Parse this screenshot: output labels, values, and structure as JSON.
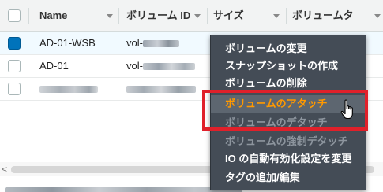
{
  "table": {
    "columns": [
      {
        "label": "Name"
      },
      {
        "label": "ボリューム ID"
      },
      {
        "label": "サイズ"
      },
      {
        "label": "ボリュームタ"
      }
    ],
    "rows": [
      {
        "name": "AD-01-WSB",
        "volume_id_prefix": "vol-",
        "selected": true
      },
      {
        "name": "AD-01",
        "volume_id_prefix": "vol-",
        "selected": false
      },
      {
        "name": "",
        "volume_id_prefix": "",
        "selected": false
      }
    ]
  },
  "scrollbar": {
    "left_arrow": "<"
  },
  "context_menu": {
    "items": [
      {
        "label": "ボリュームの変更",
        "state": "normal"
      },
      {
        "label": "スナップショットの作成",
        "state": "normal"
      },
      {
        "label": "ボリュームの削除",
        "state": "normal"
      },
      {
        "label": "ボリュームのアタッチ",
        "state": "hover"
      },
      {
        "label": "ボリュームのデタッチ",
        "state": "disabled"
      },
      {
        "label": "ボリュームの強制デタッチ",
        "state": "disabled"
      },
      {
        "label": "IO の自動有効化設定を変更",
        "state": "normal"
      },
      {
        "label": "タグの追加/編集",
        "state": "normal"
      }
    ]
  },
  "colors": {
    "header_bg": "#f2f3f3",
    "menu_bg": "#444c56",
    "menu_hover_text": "#ff9900",
    "highlight_border": "#e0202a",
    "checkbox_checked": "#0073bb"
  }
}
